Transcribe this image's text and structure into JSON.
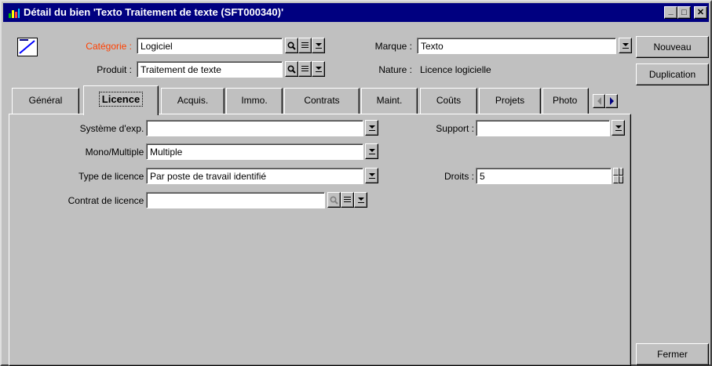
{
  "window": {
    "title": "Détail du bien 'Texto Traitement de texte (SFT000340)'",
    "minimize_label": "_",
    "maximize_label": "□",
    "close_label": "✕"
  },
  "header": {
    "categorie_label": "Catégorie :",
    "categorie_value": "Logiciel",
    "produit_label": "Produit :",
    "produit_value": "Traitement de texte",
    "marque_label": "Marque :",
    "marque_value": "Texto",
    "nature_label": "Nature :",
    "nature_value": "Licence logicielle"
  },
  "buttons": {
    "nouveau": "Nouveau",
    "duplication": "Duplication",
    "fermer": "Fermer"
  },
  "tabs": [
    {
      "label": "Général"
    },
    {
      "label": "Licence"
    },
    {
      "label": "Acquis."
    },
    {
      "label": "Immo."
    },
    {
      "label": "Contrats"
    },
    {
      "label": "Maint."
    },
    {
      "label": "Coûts"
    },
    {
      "label": "Projets"
    },
    {
      "label": "Photo"
    }
  ],
  "licence": {
    "systeme_label": "Système d'exp. :",
    "systeme_value": "",
    "mono_label": "Mono/Multiple :",
    "mono_value": "Multiple",
    "type_label": "Type de licence :",
    "type_value": "Par poste de travail identifié",
    "contrat_label": "Contrat de licence :",
    "contrat_value": "",
    "support_label": "Support :",
    "support_value": "",
    "droits_label": "Droits :",
    "droits_value": "5"
  },
  "colors": {
    "titlebar": "#000080",
    "categorie_label": "#ff4000",
    "window_bg": "#c0c0c0"
  },
  "icons": [
    "app-icon",
    "category-icon",
    "search-icon",
    "list-icon",
    "dropdown-icon",
    "scroll-left-icon",
    "scroll-right-icon",
    "spin-up-icon",
    "spin-down-icon"
  ]
}
